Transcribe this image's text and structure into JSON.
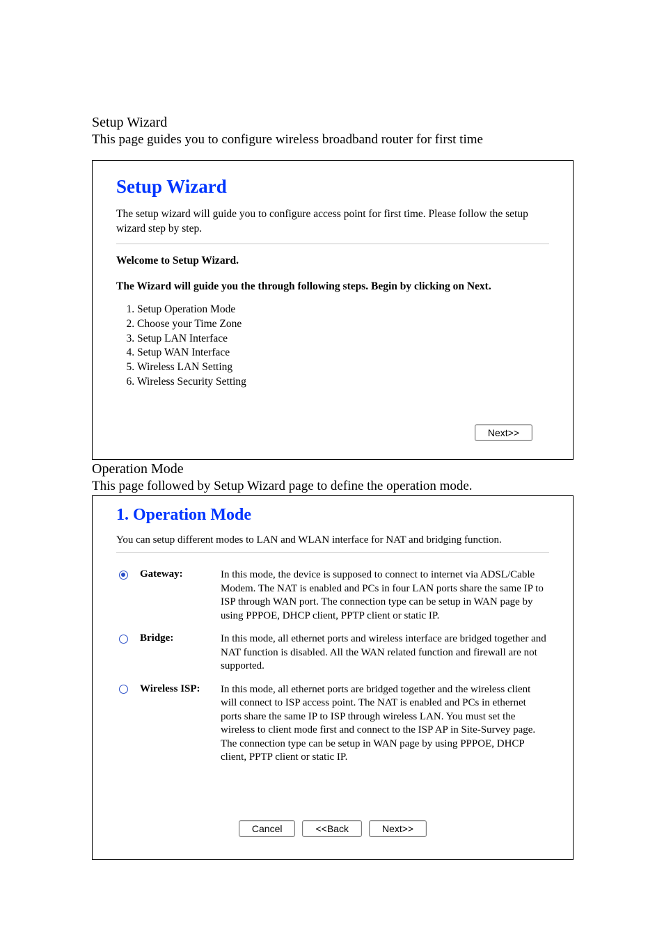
{
  "intro": {
    "section_title": "Setup Wizard",
    "section_desc": "This page guides you to configure wireless broadband router for first time"
  },
  "wizard_panel": {
    "title": "Setup Wizard",
    "desc": "The setup wizard will guide you to configure access point for first time. Please follow the setup wizard step by step.",
    "welcome": "Welcome to Setup Wizard.",
    "guide_line": "The Wizard will guide you the through following steps. Begin by clicking on Next.",
    "steps": [
      "Setup Operation Mode",
      "Choose your Time Zone",
      "Setup LAN Interface",
      "Setup WAN Interface",
      "Wireless LAN Setting",
      "Wireless Security Setting"
    ],
    "next_label": "Next>>"
  },
  "opmode_intro": {
    "section_title": "Operation Mode",
    "section_desc": "This page followed by Setup Wizard page to define the operation mode."
  },
  "opmode_panel": {
    "title": "1. Operation Mode",
    "desc": "You can setup different modes to LAN and WLAN interface for NAT and bridging function.",
    "modes": {
      "gateway": {
        "label": "Gateway:",
        "selected": true,
        "text": "In this mode, the device is supposed to connect to internet via ADSL/Cable Modem. The NAT is enabled and PCs in four LAN ports share the same IP to ISP through WAN port. The connection type can be setup in WAN page by using PPPOE, DHCP client, PPTP client or static IP."
      },
      "bridge": {
        "label": "Bridge:",
        "selected": false,
        "text": "In this mode, all ethernet ports and wireless interface are bridged together and NAT function is disabled. All the WAN related function and firewall are not supported."
      },
      "wisp": {
        "label": "Wireless ISP:",
        "selected": false,
        "text": "In this mode, all ethernet ports are bridged together and the wireless client will connect to ISP access point. The NAT is enabled and PCs in ethernet ports share the same IP to ISP through wireless LAN. You must set the wireless to client mode first and connect to the ISP AP in Site-Survey page. The connection type can be setup in WAN page by using PPPOE, DHCP client, PPTP client or static IP."
      }
    },
    "buttons": {
      "cancel": "Cancel",
      "back": "<<Back",
      "next": "Next>>"
    }
  }
}
